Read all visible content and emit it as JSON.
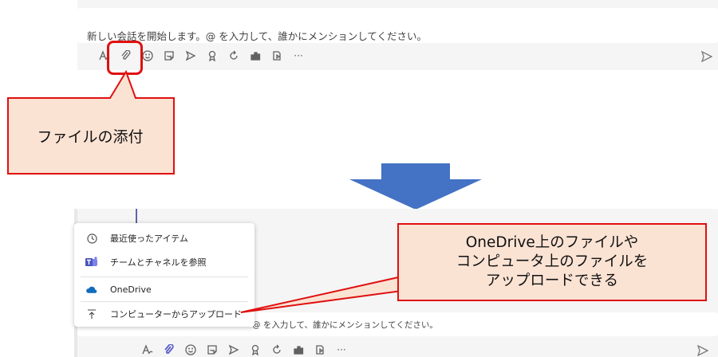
{
  "compose": {
    "placeholder": "新しい会話を開始します。@ を入力して、誰かにメンションしてください。",
    "placeholder_partial": "@ を入力して、誰かにメンションしてください。",
    "more_label": "···"
  },
  "toolbar_icons": [
    "format-icon",
    "attach-icon",
    "emoji-icon",
    "sticker-icon",
    "meet-icon",
    "praise-icon",
    "loop-icon",
    "approvals-icon",
    "stream-icon",
    "more-icon",
    "send-icon"
  ],
  "callout_attach": {
    "text": "ファイルの添付"
  },
  "callout_upload": {
    "line1": "OneDrive上のファイルや",
    "line2": "コンピュータ上のファイルを",
    "line3": "アップロードできる"
  },
  "attach_menu": {
    "items": [
      {
        "label": "最近使ったアイテム",
        "icon": "clock-icon"
      },
      {
        "label": "チームとチャネルを参照",
        "icon": "teams-icon"
      },
      {
        "label": "OneDrive",
        "icon": "onedrive-icon"
      },
      {
        "label": "コンピューターからアップロード",
        "icon": "upload-icon"
      }
    ]
  },
  "colors": {
    "highlight": "#e01010",
    "callout_bg": "#fbe3d4",
    "arrow": "#4472c4",
    "teams_purple": "#5b5fc7",
    "onedrive_blue": "#0f6cbd"
  }
}
